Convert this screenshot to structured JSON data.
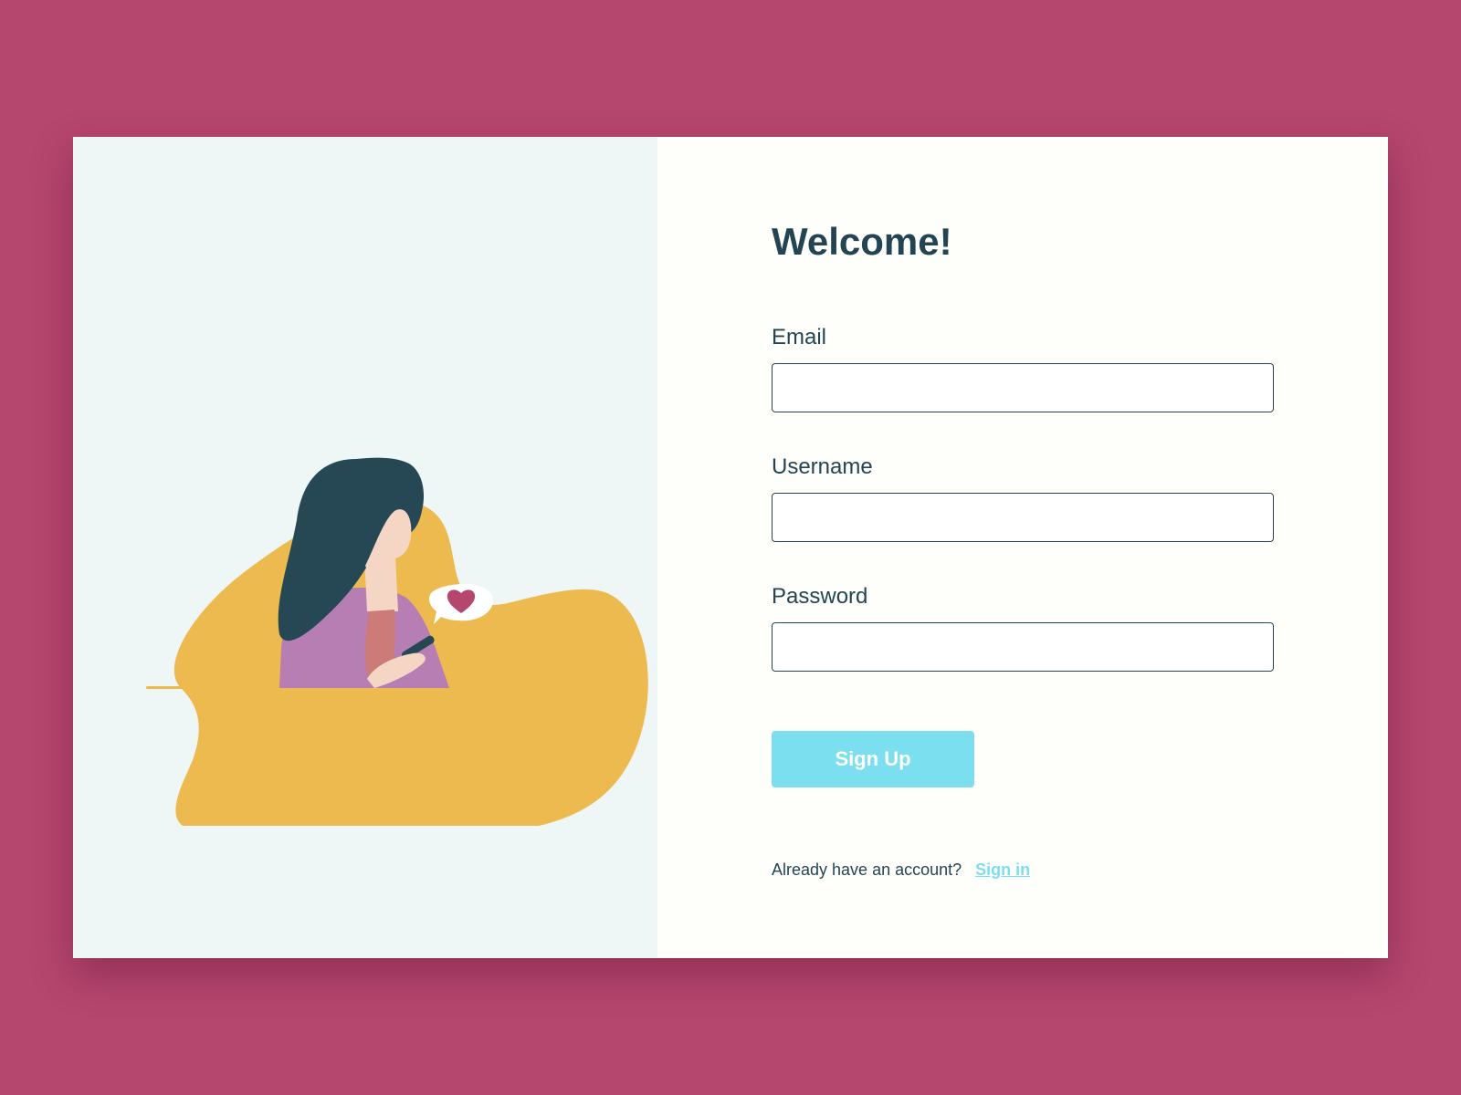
{
  "colors": {
    "page_background": "#b5466e",
    "illustration_background": "#eef6f6",
    "form_background": "#fefefa",
    "text_primary": "#234553",
    "accent": "#7cdff0",
    "blob": "#edba4f",
    "heart": "#b5466e"
  },
  "form": {
    "title": "Welcome!",
    "email": {
      "label": "Email",
      "value": "",
      "placeholder": ""
    },
    "username": {
      "label": "Username",
      "value": "",
      "placeholder": ""
    },
    "password": {
      "label": "Password",
      "value": "",
      "placeholder": ""
    },
    "submit_label": "Sign Up"
  },
  "footer": {
    "prompt": "Already have an account?",
    "link_label": "Sign in"
  },
  "illustration": {
    "icons": [
      "woman-illustration",
      "phone-icon",
      "heart-icon",
      "speech-bubble-icon"
    ]
  }
}
